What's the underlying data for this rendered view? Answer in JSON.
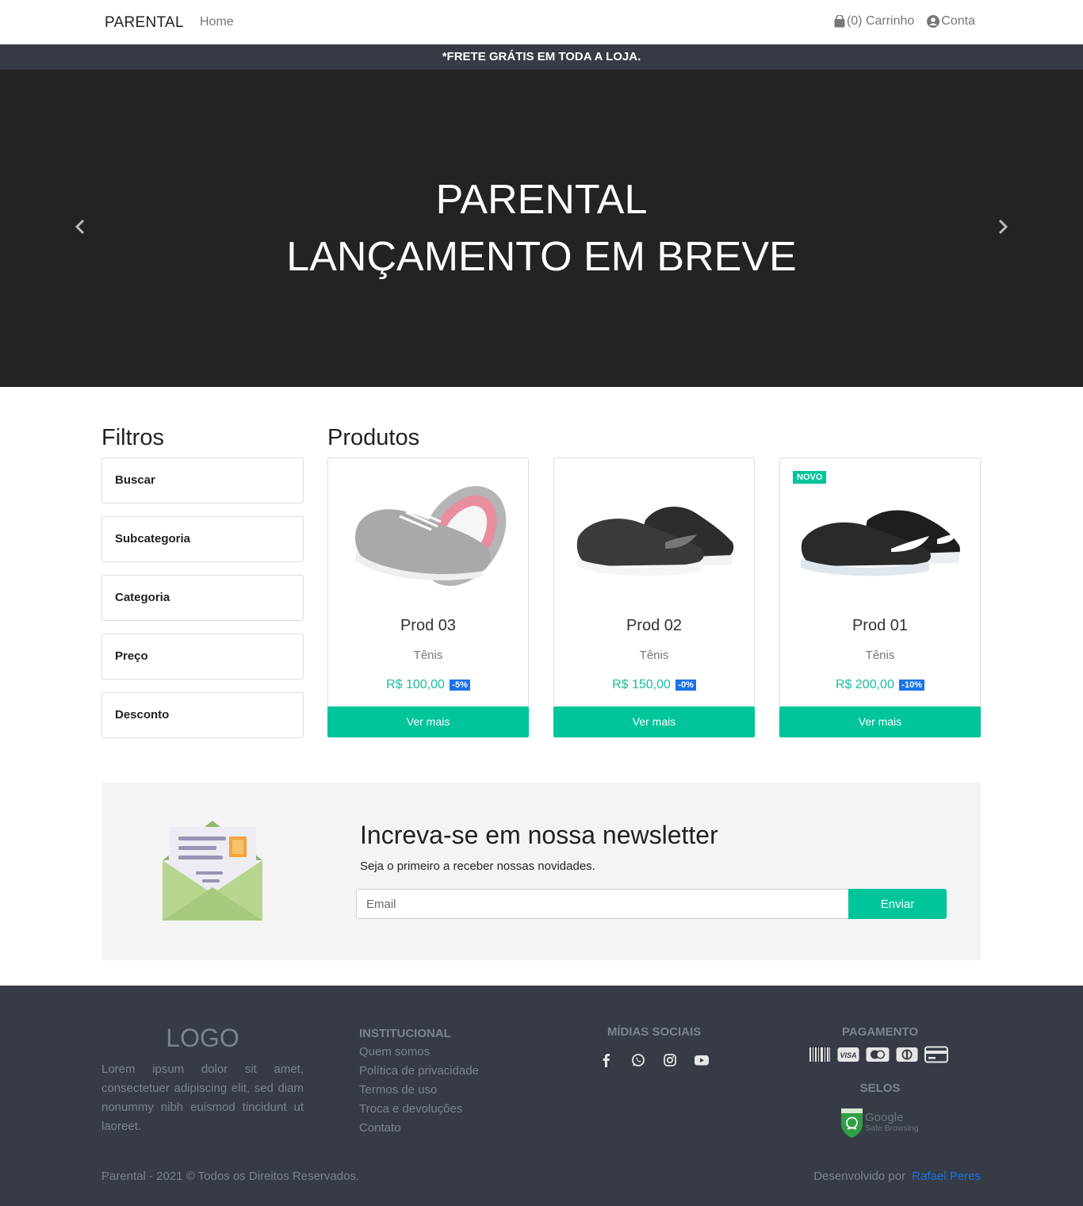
{
  "navbar": {
    "brand": "PARENTAL",
    "home": "Home",
    "cart": "(0) Carrinho",
    "account": "Conta"
  },
  "announcement": "*FRETE GRÁTIS EM TODA A LOJA.",
  "hero": {
    "line1": "PARENTAL",
    "line2": "LANÇAMENTO EM BREVE"
  },
  "filters": {
    "title": "Filtros",
    "items": [
      "Buscar",
      "Subcategoria",
      "Categoria",
      "Preço",
      "Desconto"
    ]
  },
  "products": {
    "title": "Produtos",
    "items": [
      {
        "name": "Prod 03",
        "category": "Tênis",
        "price": "R$ 100,00",
        "discount": "-5%",
        "button": "Ver mais",
        "badge": ""
      },
      {
        "name": "Prod 02",
        "category": "Tênis",
        "price": "R$ 150,00",
        "discount": "-0%",
        "button": "Ver mais",
        "badge": ""
      },
      {
        "name": "Prod 01",
        "category": "Tênis",
        "price": "R$ 200,00",
        "discount": "-10%",
        "button": "Ver mais",
        "badge": "NOVO"
      }
    ]
  },
  "newsletter": {
    "title": "Increva-se em nossa newsletter",
    "subtitle": "Seja o primeiro a receber nossas novidades.",
    "placeholder": "Email",
    "button": "Enviar"
  },
  "footer": {
    "logo": "LOGO",
    "description": "Lorem ipsum dolor sit amet, consectetuer adipiscing elit, sed diam nonummy nibh euismod tincidunt ut laoreet.",
    "institucional_title": "INSTITUCIONAL",
    "institucional_links": [
      "Quem somos",
      "Política de privacidade",
      "Termos de uso",
      "Troca e devoluções",
      "Contato"
    ],
    "social_title": "MÍDIAS SOCIAIS",
    "social_icons": [
      "facebook-icon",
      "whatsapp-icon",
      "instagram-icon",
      "youtube-icon"
    ],
    "payment_title": "PAGAMENTO",
    "payment_icons": [
      "barcode-icon",
      "visa-icon",
      "mastercard-icon",
      "diners-icon",
      "credit-card-icon"
    ],
    "seals_title": "SELOS",
    "seal_text_1": "Google",
    "seal_text_2": "Safe Browsing",
    "copyright": "Parental - 2021 © Todos os Direitos Reservados.",
    "developed_by": "Desenvolvido por",
    "developer": "Rafael Peres"
  },
  "colors": {
    "accent": "#00c49a",
    "dark": "#363b45",
    "hero_bg": "#232323",
    "discount": "#1a73e8"
  }
}
